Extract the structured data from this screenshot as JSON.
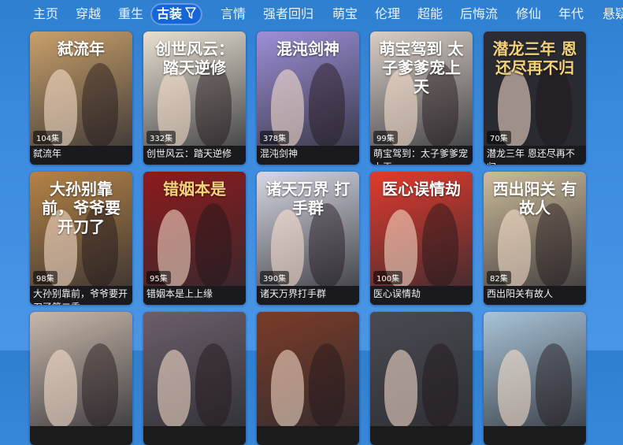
{
  "tabs": [
    {
      "label": "主页",
      "active": false
    },
    {
      "label": "穿越",
      "active": false
    },
    {
      "label": "重生",
      "active": false
    },
    {
      "label": "古装",
      "active": true
    },
    {
      "label": "言情",
      "active": false
    },
    {
      "label": "强者回归",
      "active": false
    },
    {
      "label": "萌宝",
      "active": false
    },
    {
      "label": "伦理",
      "active": false
    },
    {
      "label": "超能",
      "active": false
    },
    {
      "label": "后悔流",
      "active": false
    },
    {
      "label": "修仙",
      "active": false
    },
    {
      "label": "年代",
      "active": false
    },
    {
      "label": "悬疑",
      "active": false
    }
  ],
  "filter_icon": "filter-icon",
  "dramas": [
    {
      "title": "弑流年",
      "episodes": "104集",
      "poster_text": "弑流年",
      "color": "#c9a06a"
    },
    {
      "title": "创世风云：踏天逆修",
      "episodes": "332集",
      "poster_text": "创世风云：踏天逆修",
      "color": "#e8e1d2"
    },
    {
      "title": "混沌剑神",
      "episodes": "378集",
      "poster_text": "混沌剑神",
      "color": "#9d8fd8"
    },
    {
      "title": "萌宝驾到：太子爹爹宠上天",
      "episodes": "99集",
      "poster_text": "萌宝驾到 太子爹爹宠上天",
      "color": "#d9cfc6"
    },
    {
      "title": "潜龙三年 恩还尽再不归",
      "episodes": "70集",
      "poster_text": "潜龙三年 恩还尽再不归",
      "color": "#2a2b33"
    },
    {
      "title": "大孙别靠前，爷爷要开刀了第二季",
      "episodes": "98集",
      "poster_text": "大孙别靠前，爷爷要开刀了",
      "color": "#b58347"
    },
    {
      "title": "错姻本是上上缘",
      "episodes": "95集",
      "poster_text": "错姻本是",
      "color": "#8e1a1c"
    },
    {
      "title": "诸天万界打手群",
      "episodes": "390集",
      "poster_text": "诸天万界 打手群",
      "color": "#d8d8e4"
    },
    {
      "title": "医心误情劫",
      "episodes": "100集",
      "poster_text": "医心误情劫",
      "color": "#e23a2d"
    },
    {
      "title": "西出阳关有故人",
      "episodes": "82集",
      "poster_text": "西出阳关 有故人",
      "color": "#cdbb9a"
    },
    {
      "title": "",
      "episodes": "",
      "poster_text": "",
      "color": "#c8b8aa"
    },
    {
      "title": "",
      "episodes": "",
      "poster_text": "",
      "color": "#6b5e6a"
    },
    {
      "title": "",
      "episodes": "",
      "poster_text": "",
      "color": "#7a3b28"
    },
    {
      "title": "",
      "episodes": "",
      "poster_text": "",
      "color": "#4a4a52"
    },
    {
      "title": "",
      "episodes": "",
      "poster_text": "",
      "color": "#a8c4d8"
    }
  ]
}
